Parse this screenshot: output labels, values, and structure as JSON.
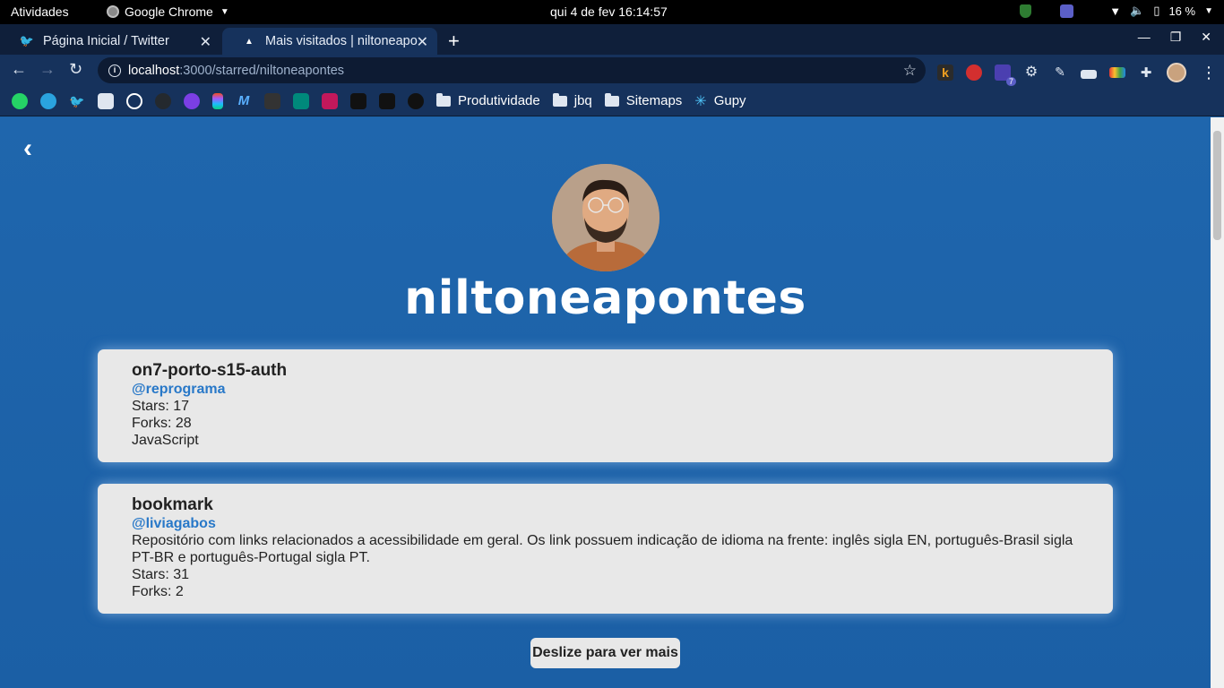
{
  "system": {
    "activities": "Atividades",
    "app_name": "Google Chrome",
    "clock": "qui 4 de fev  16:14:57",
    "battery": "16 %"
  },
  "browser": {
    "tabs": [
      {
        "title": "Página Inicial / Twitter",
        "icon": "twitter-icon"
      },
      {
        "title": "Mais visitados | niltoneapontes",
        "icon": "site-favicon"
      }
    ],
    "url": {
      "host": "localhost",
      "path": ":3000/starred/niltoneapontes"
    },
    "extensions_badge": "7",
    "bookmarks": {
      "folders": [
        "Produtividade",
        "jbq",
        "Sitemaps"
      ],
      "gupy": "Gupy"
    }
  },
  "profile": {
    "username": "niltoneapontes"
  },
  "repos": [
    {
      "name": "on7-porto-s15-auth",
      "owner": "@reprograma",
      "stars": "Stars: 17",
      "forks": "Forks: 28",
      "language": "JavaScript"
    },
    {
      "name": "bookmark",
      "owner": "@liviagabos",
      "description": "Repositório com links relacionados a acessibilidade em geral. Os link possuem indicação de idioma na frente: inglês sigla EN, português-Brasil sigla PT-BR e português-Portugal sigla PT.",
      "stars": "Stars: 31",
      "forks": "Forks: 2"
    }
  ],
  "load_more": "Deslize para ver mais",
  "colors": {
    "page_bg": "#1d63a8",
    "card_bg": "#e8e8e8",
    "owner_link": "#2878c8",
    "chrome_frame": "#16325c"
  }
}
